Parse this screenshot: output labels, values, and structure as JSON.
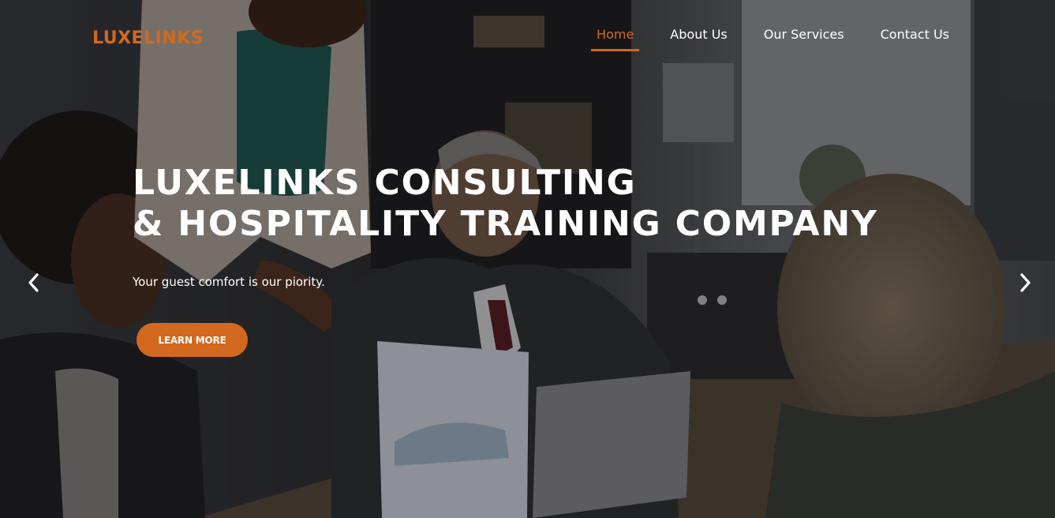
{
  "brand": {
    "logo_text": "LUXELINKS",
    "accent_color": "#d2691e"
  },
  "nav": {
    "items": [
      {
        "label": "Home",
        "active": true
      },
      {
        "label": "About Us",
        "active": false
      },
      {
        "label": "Our Services",
        "active": false
      },
      {
        "label": "Contact Us",
        "active": false
      }
    ]
  },
  "hero": {
    "title_line1": "LUXELINKS CONSULTING",
    "title_line2": "& HOSPITALITY TRAINING COMPANY",
    "subtitle": "Your guest comfort is our piority.",
    "cta_label": "LEARN MORE",
    "background_image": "business meeting photo with four people reviewing documents and a laptop",
    "prev_icon": "chevron-left-icon",
    "next_icon": "chevron-right-icon"
  }
}
